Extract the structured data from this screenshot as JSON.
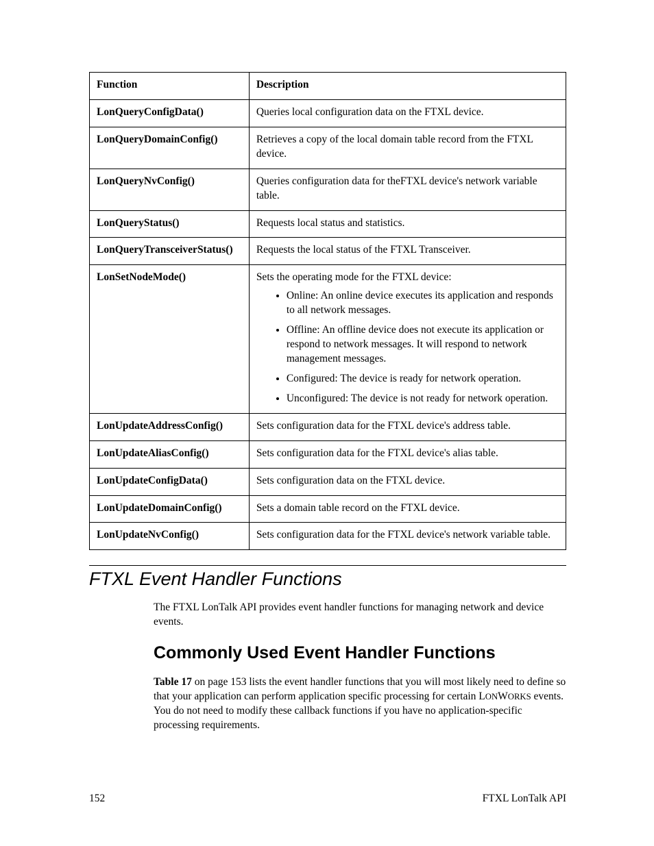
{
  "table": {
    "head": {
      "fn": "Function",
      "desc": "Description"
    },
    "rows": [
      {
        "fn": "LonQueryConfigData()",
        "desc": "Queries local configuration data on the FTXL device."
      },
      {
        "fn": "LonQueryDomainConfig()",
        "desc": "Retrieves a copy of the local domain table record from the FTXL device."
      },
      {
        "fn": "LonQueryNvConfig()",
        "desc": "Queries configuration data for theFTXL device's network variable table."
      },
      {
        "fn": "LonQueryStatus()",
        "desc": "Requests local status and statistics."
      },
      {
        "fn": "LonQueryTransceiverStatus()",
        "desc": "Requests the local status of the FTXL Transceiver."
      },
      {
        "fn": "LonSetNodeMode()",
        "intro": "Sets the operating mode for the FTXL device:",
        "bullets": [
          "Online:  An online device executes its application and responds to all network messages.",
          "Offline:  An offline device does not execute its application or respond to network messages. It will respond to network management messages.",
          "Configured:  The device is ready for network operation.",
          "Unconfigured:  The device is not ready for network operation."
        ]
      },
      {
        "fn": "LonUpdateAddressConfig()",
        "desc": "Sets configuration data for the FTXL device's address table."
      },
      {
        "fn": "LonUpdateAliasConfig()",
        "desc": "Sets configuration data for the FTXL device's alias table."
      },
      {
        "fn": "LonUpdateConfigData()",
        "desc": "Sets configuration data on the FTXL device."
      },
      {
        "fn": "LonUpdateDomainConfig()",
        "desc": "Sets a domain table record on the FTXL device."
      },
      {
        "fn": "LonUpdateNvConfig()",
        "desc": "Sets configuration data for the FTXL device's network variable table."
      }
    ]
  },
  "section": {
    "title": "FTXL Event Handler Functions",
    "intro": "The FTXL LonTalk API provides event handler functions for managing network and device events.",
    "sub_title": "Commonly Used Event Handler Functions",
    "sub_para_pre": "Table 17",
    "sub_para_mid1": " on page 153 lists the event handler functions that you will most likely need to define so that your application can perform application specific processing for certain L",
    "sub_para_sc1": "ON",
    "sub_para_mid2": "W",
    "sub_para_sc2": "ORKS",
    "sub_para_tail": " events.  You do not need to modify these callback functions if you have no application-specific processing requirements."
  },
  "footer": {
    "left": "152",
    "right": "FTXL LonTalk API"
  }
}
